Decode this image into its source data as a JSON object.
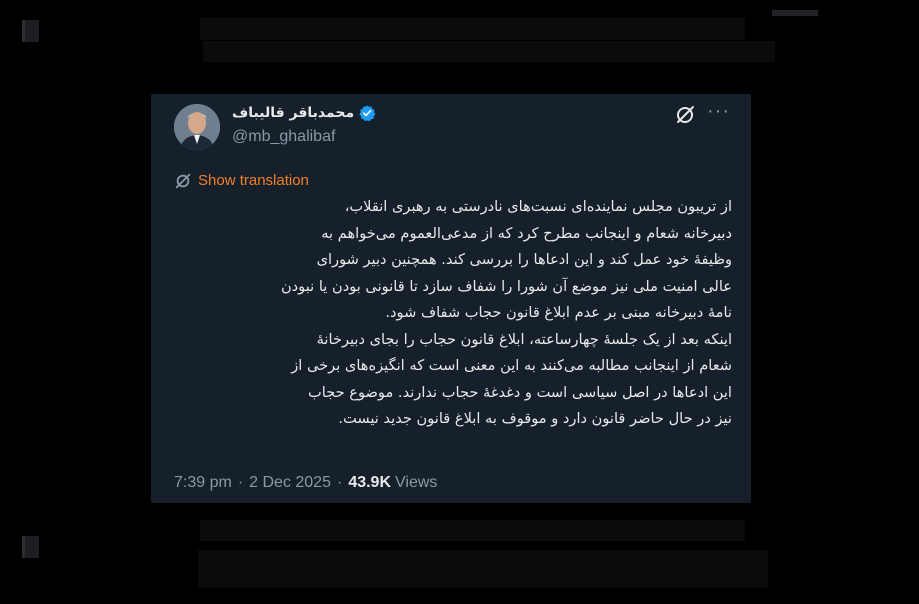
{
  "tweet": {
    "display_name": "محمدباقر قالیباف",
    "handle": "@mb_ghalibaf",
    "translate_label": "Show translation",
    "lines": [
      "از تریبون مجلس نماینده‌ای نسبت‌های نادرستی به رهبری انقلاب،",
      "دبیرخانه شعام و اینجانب مطرح کرد که از مدعی‌العموم  می‌خواهم به",
      "وظیفهٔ خود عمل کند و این ادعاها را بررسی کند. همچنین دبیر شورای",
      "عالی امنیت ملی نیز موضع آن شورا را شفاف سازد تا قانونی بودن یا نبودن",
      "نامهٔ دبیرخانه مبنی بر عدم ابلاغ قانون حجاب شفاف شود.",
      "اینکه بعد از یک جلسهٔ چهارساعته، ابلاغ قانون حجاب را بجای دبیرخانهٔ",
      "شعام از اینجانب مطالبه می‌کنند به این معنی است که انگیزه‌های برخی از",
      "این ادعاها در اصل سیاسی است و دغدغهٔ حجاب ندارند. موضوع حجاب",
      "نیز در حال حاضر قانون دارد و موقوف به ابلاغ قانون جدید نیست."
    ],
    "time": "7:39 pm",
    "separator": "·",
    "date": "2 Dec 2025",
    "views_count": "43.9K",
    "views_label": "Views"
  },
  "colors": {
    "card_bg": "#15202b",
    "text": "#e7e9ea",
    "muted": "#8b98a5",
    "translate_accent": "#f17f26",
    "verified": "#1d9bf0"
  },
  "icons": {
    "verified": "verified-badge-icon",
    "grok": "grok-icon",
    "more": "more-options-icon",
    "translate": "translate-icon"
  }
}
